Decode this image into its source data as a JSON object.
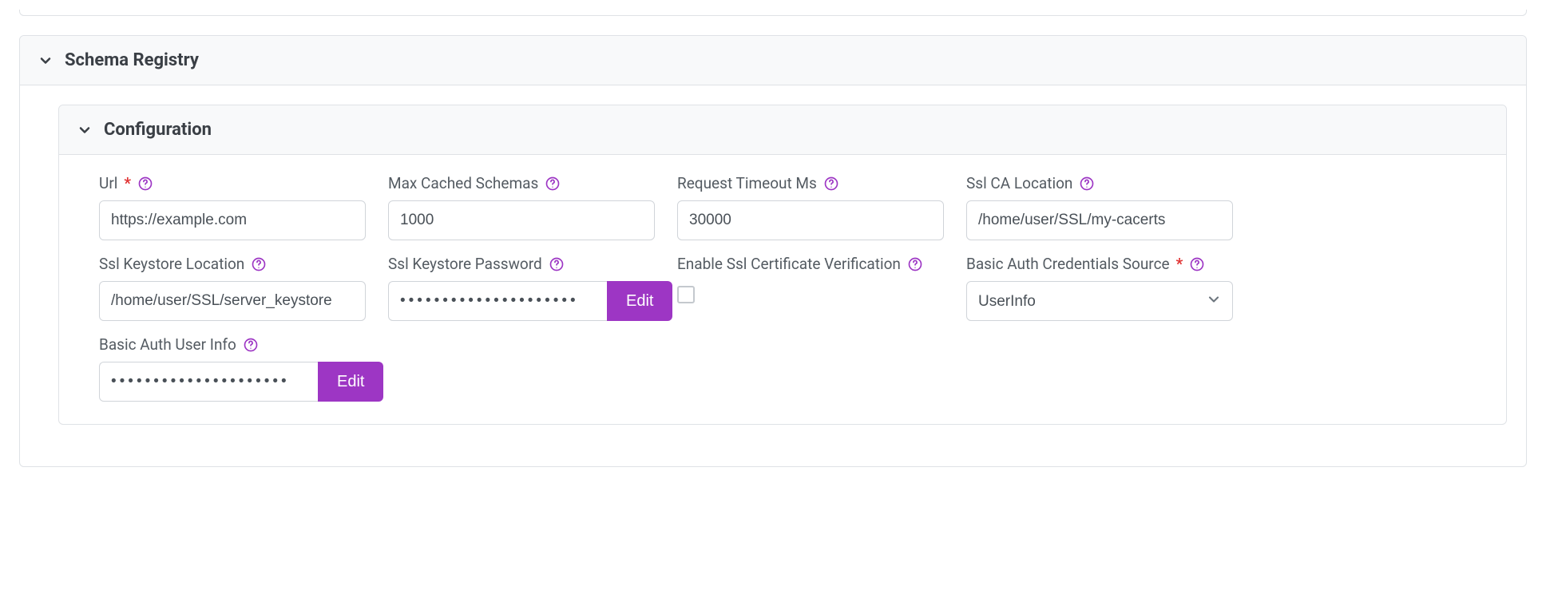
{
  "section": {
    "title": "Schema Registry",
    "config_title": "Configuration"
  },
  "fields": {
    "url": {
      "label": "Url",
      "required": true,
      "value": "https://example.com"
    },
    "maxCachedSchemas": {
      "label": "Max Cached Schemas",
      "value": "1000"
    },
    "requestTimeoutMs": {
      "label": "Request Timeout Ms",
      "value": "30000"
    },
    "sslCaLocation": {
      "label": "Ssl CA Location",
      "value": "/home/user/SSL/my-cacerts"
    },
    "sslKeystoreLocation": {
      "label": "Ssl Keystore Location",
      "value": "/home/user/SSL/server_keystore"
    },
    "sslKeystorePassword": {
      "label": "Ssl Keystore Password",
      "edit_label": "Edit"
    },
    "enableSslCertVerification": {
      "label": "Enable Ssl Certificate Verification",
      "checked": false
    },
    "basicAuthCredentialsSource": {
      "label": "Basic Auth Credentials Source",
      "required": true,
      "selected": "UserInfo"
    },
    "basicAuthUserInfo": {
      "label": "Basic Auth User Info",
      "edit_label": "Edit"
    }
  },
  "colors": {
    "accent": "#9d36c4",
    "helpRing": "#9d36c4",
    "required": "#e03131"
  }
}
